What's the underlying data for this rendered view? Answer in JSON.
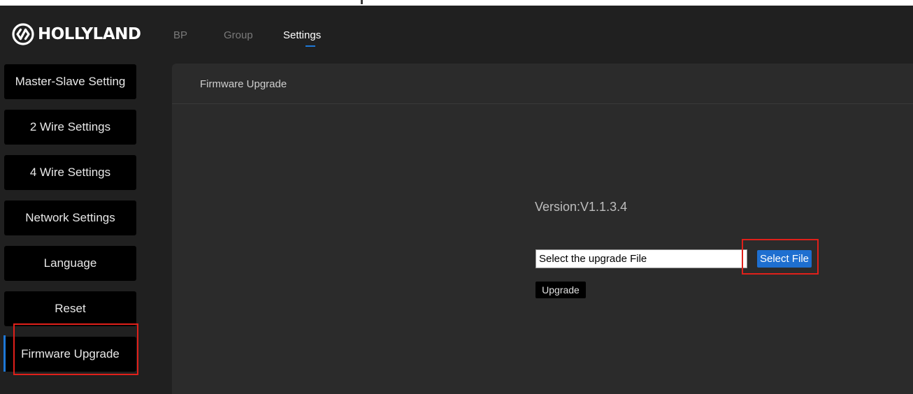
{
  "app": {
    "brand": "HOLLYLAND",
    "logo_icon": "hollyland-logo-icon"
  },
  "nav": {
    "tabs": [
      {
        "label": "BP",
        "active": false
      },
      {
        "label": "Group",
        "active": false
      },
      {
        "label": "Settings",
        "active": true
      }
    ]
  },
  "sidebar": {
    "items": [
      {
        "label": "Master-Slave Setting"
      },
      {
        "label": "2 Wire Settings"
      },
      {
        "label": "4 Wire Settings"
      },
      {
        "label": "Network Settings"
      },
      {
        "label": "Language"
      },
      {
        "label": "Reset"
      },
      {
        "label": "Firmware Upgrade",
        "active": true
      }
    ]
  },
  "main": {
    "title": "Firmware Upgrade",
    "version_text": "Version:V1.1.3.4",
    "file_input_value": "Select the upgrade File",
    "select_file_label": "Select File",
    "upgrade_label": "Upgrade"
  },
  "colors": {
    "accent": "#1e78d6",
    "highlight": "#e0201a",
    "background": "#202020",
    "panel": "#2b2b2b"
  }
}
